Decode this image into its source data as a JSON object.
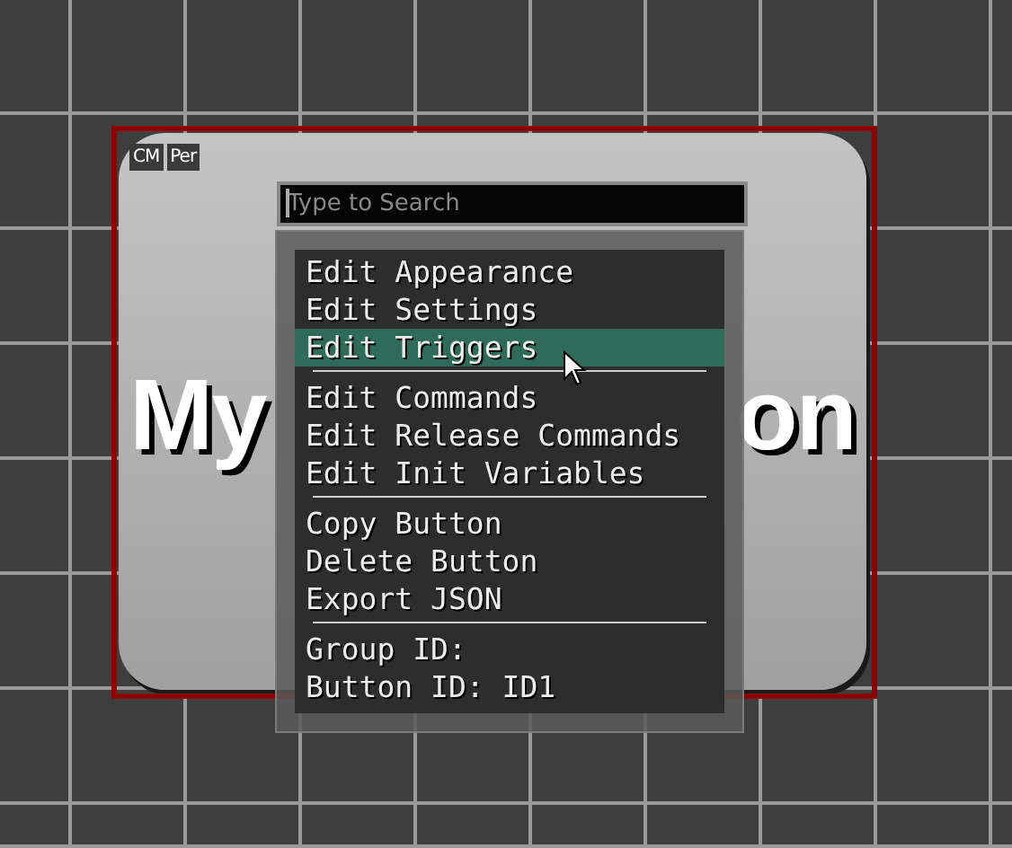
{
  "button": {
    "label_parts": [
      "My",
      "on"
    ],
    "badges": [
      "CM",
      "Per"
    ],
    "selected": true
  },
  "search": {
    "placeholder": "Type to Search"
  },
  "menu": {
    "groups": [
      {
        "items": [
          {
            "label": "Edit Appearance",
            "selected": false
          },
          {
            "label": "Edit Settings",
            "selected": false
          },
          {
            "label": "Edit Triggers",
            "selected": true
          }
        ]
      },
      {
        "items": [
          {
            "label": "Edit Commands",
            "selected": false
          },
          {
            "label": "Edit Release Commands",
            "selected": false
          },
          {
            "label": "Edit Init Variables",
            "selected": false
          }
        ]
      },
      {
        "items": [
          {
            "label": "Copy Button",
            "selected": false
          },
          {
            "label": "Delete Button",
            "selected": false
          },
          {
            "label": "Export JSON",
            "selected": false
          }
        ]
      },
      {
        "items": [
          {
            "label": "Group ID:",
            "selected": false
          },
          {
            "label": "Button ID: ID1",
            "selected": false
          }
        ]
      }
    ]
  }
}
